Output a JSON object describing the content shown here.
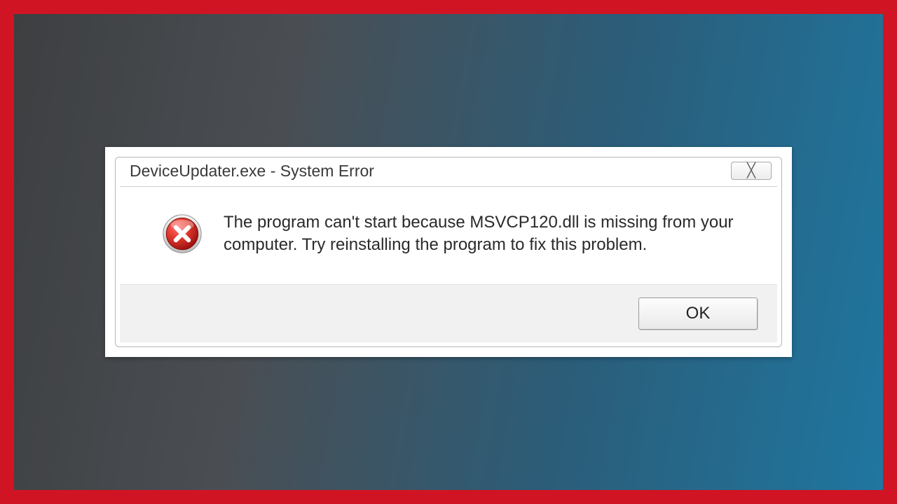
{
  "colors": {
    "frame": "#d11423"
  },
  "dialog": {
    "title": "DeviceUpdater.exe - System Error",
    "close_label": "✕",
    "message": "The program can't start because MSVCP120.dll is missing from your computer. Try reinstalling the program to fix this problem.",
    "ok_label": "OK",
    "icon": "error-icon"
  }
}
